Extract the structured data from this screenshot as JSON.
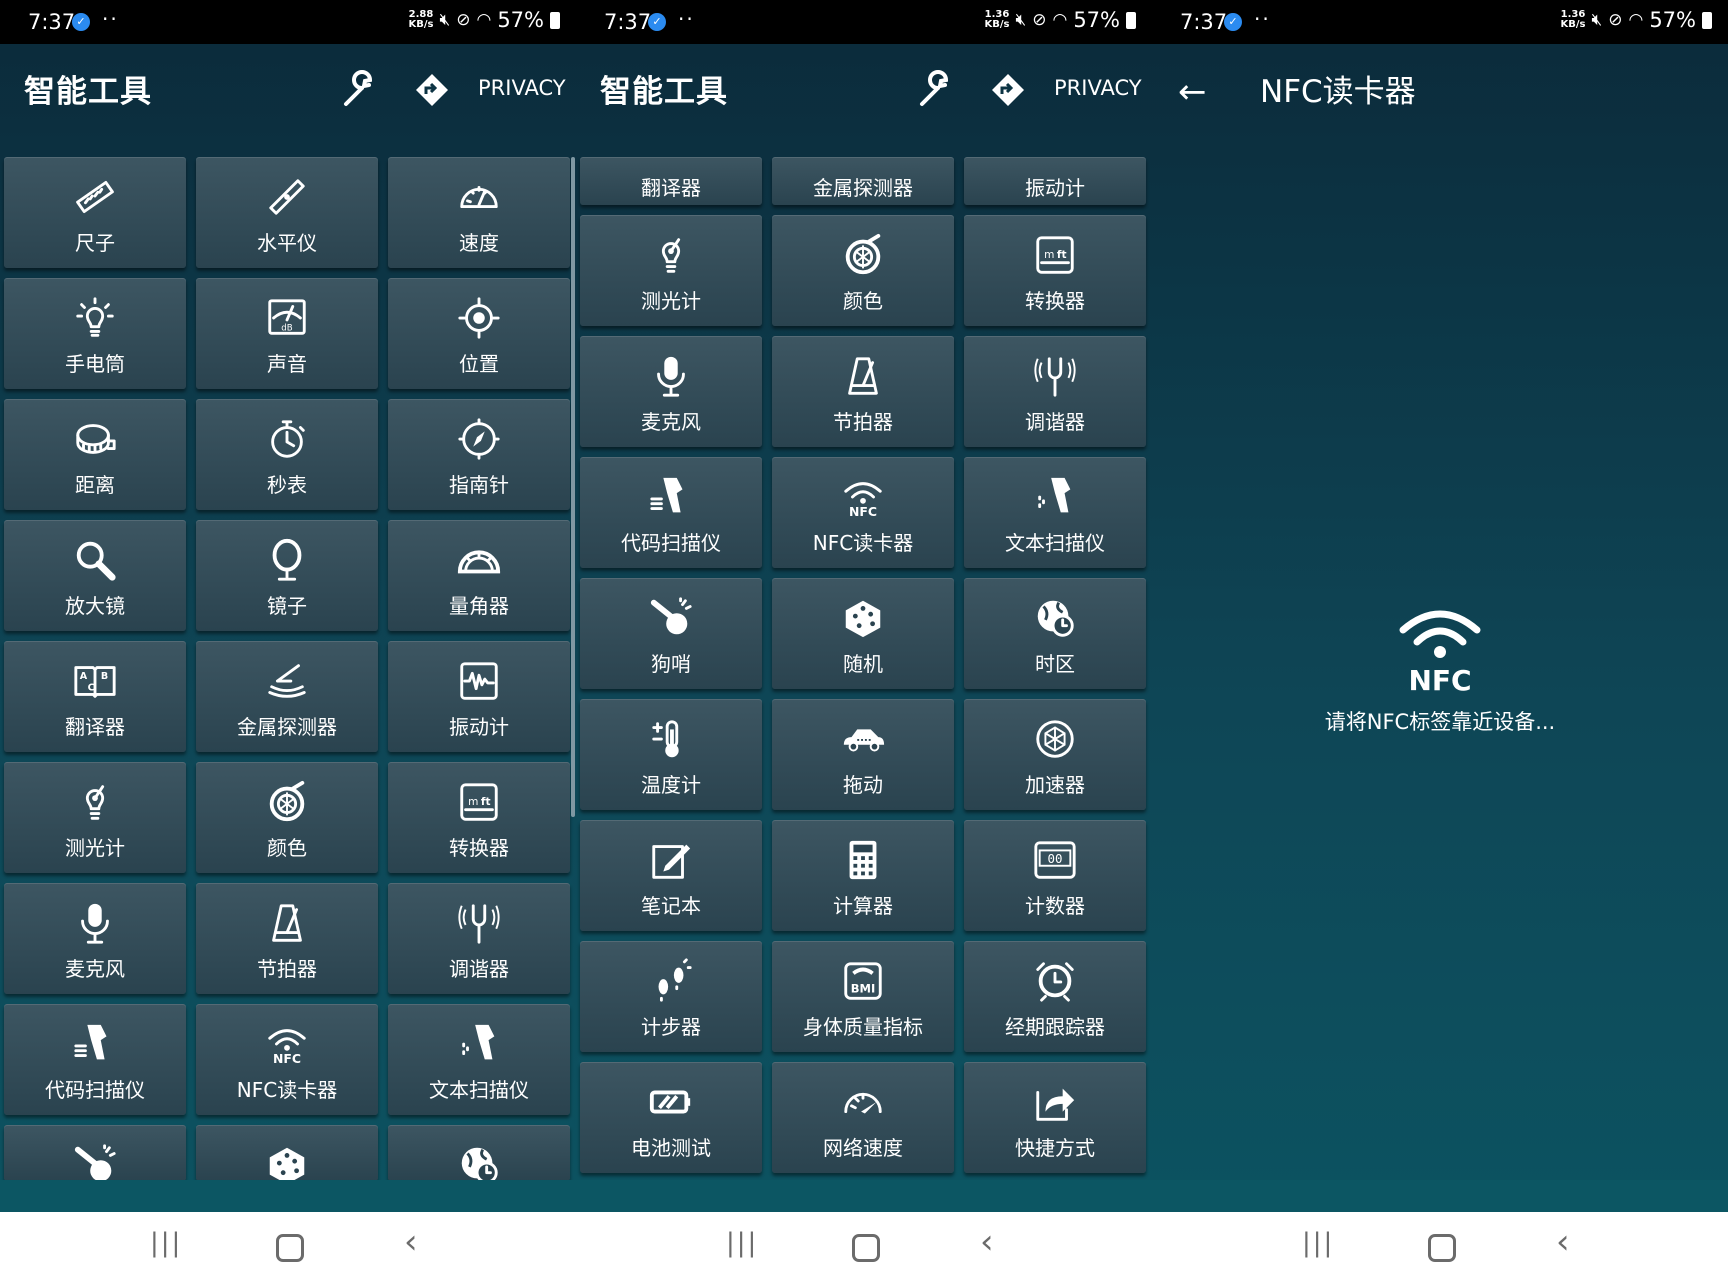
{
  "status_bar": {
    "time": "7:37",
    "battery": "57%",
    "speed_left": "2.88",
    "speed_right": "1.36",
    "speed_unit": "KB/s"
  },
  "app": {
    "title": "智能工具",
    "privacy_label": "PRIVACY"
  },
  "panel1_tiles": [
    {
      "label": "尺子",
      "icon": "ruler-icon"
    },
    {
      "label": "水平仪",
      "icon": "level-icon"
    },
    {
      "label": "速度",
      "icon": "speedometer-icon"
    },
    {
      "label": "手电筒",
      "icon": "flashlight-icon"
    },
    {
      "label": "声音",
      "icon": "sound-meter-icon"
    },
    {
      "label": "位置",
      "icon": "location-icon"
    },
    {
      "label": "距离",
      "icon": "tape-measure-icon"
    },
    {
      "label": "秒表",
      "icon": "stopwatch-icon"
    },
    {
      "label": "指南针",
      "icon": "compass-icon"
    },
    {
      "label": "放大镜",
      "icon": "magnifier-icon"
    },
    {
      "label": "镜子",
      "icon": "mirror-icon"
    },
    {
      "label": "量角器",
      "icon": "protractor-icon"
    },
    {
      "label": "翻译器",
      "icon": "translator-icon"
    },
    {
      "label": "金属探测器",
      "icon": "metal-detector-icon"
    },
    {
      "label": "振动计",
      "icon": "vibration-icon"
    },
    {
      "label": "测光计",
      "icon": "light-meter-icon"
    },
    {
      "label": "颜色",
      "icon": "color-icon"
    },
    {
      "label": "转换器",
      "icon": "converter-icon"
    },
    {
      "label": "麦克风",
      "icon": "microphone-icon"
    },
    {
      "label": "节拍器",
      "icon": "metronome-icon"
    },
    {
      "label": "调谐器",
      "icon": "tuning-fork-icon"
    },
    {
      "label": "代码扫描仪",
      "icon": "barcode-scanner-icon"
    },
    {
      "label": "NFC读卡器",
      "icon": "nfc-icon"
    },
    {
      "label": "文本扫描仪",
      "icon": "text-scanner-icon"
    }
  ],
  "panel1_partial": [
    {
      "label": "",
      "icon": "whistle-icon"
    },
    {
      "label": "",
      "icon": "dice-icon"
    },
    {
      "label": "",
      "icon": "globe-clock-icon"
    }
  ],
  "panel2_top": [
    {
      "label": "翻译器"
    },
    {
      "label": "金属探测器"
    },
    {
      "label": "振动计"
    }
  ],
  "panel2_tiles": [
    {
      "label": "测光计",
      "icon": "light-meter-icon"
    },
    {
      "label": "颜色",
      "icon": "color-icon"
    },
    {
      "label": "转换器",
      "icon": "converter-icon"
    },
    {
      "label": "麦克风",
      "icon": "microphone-icon"
    },
    {
      "label": "节拍器",
      "icon": "metronome-icon"
    },
    {
      "label": "调谐器",
      "icon": "tuning-fork-icon"
    },
    {
      "label": "代码扫描仪",
      "icon": "barcode-scanner-icon"
    },
    {
      "label": "NFC读卡器",
      "icon": "nfc-icon"
    },
    {
      "label": "文本扫描仪",
      "icon": "text-scanner-icon"
    },
    {
      "label": "狗哨",
      "icon": "whistle-icon"
    },
    {
      "label": "随机",
      "icon": "dice-icon"
    },
    {
      "label": "时区",
      "icon": "globe-clock-icon"
    },
    {
      "label": "温度计",
      "icon": "thermometer-icon"
    },
    {
      "label": "拖动",
      "icon": "car-icon"
    },
    {
      "label": "加速器",
      "icon": "accelerometer-icon"
    },
    {
      "label": "笔记本",
      "icon": "notebook-icon"
    },
    {
      "label": "计算器",
      "icon": "calculator-icon"
    },
    {
      "label": "计数器",
      "icon": "counter-icon"
    },
    {
      "label": "计步器",
      "icon": "footsteps-icon"
    },
    {
      "label": "身体质量指标",
      "icon": "bmi-icon"
    },
    {
      "label": "经期跟踪器",
      "icon": "alarm-clock-icon"
    },
    {
      "label": "电池测试",
      "icon": "battery-icon"
    },
    {
      "label": "网络速度",
      "icon": "network-speed-icon"
    },
    {
      "label": "快捷方式",
      "icon": "shortcut-icon"
    }
  ],
  "nfc_screen": {
    "title": "NFC读卡器",
    "nfc_text": "NFC",
    "message": "请将NFC标签靠近设备..."
  },
  "icon_color": "#ffffff",
  "text_labels": {
    "nfc_badge": "NFC",
    "bmi_badge": "BMI",
    "db_badge": "dB",
    "counter_badge": "00"
  }
}
